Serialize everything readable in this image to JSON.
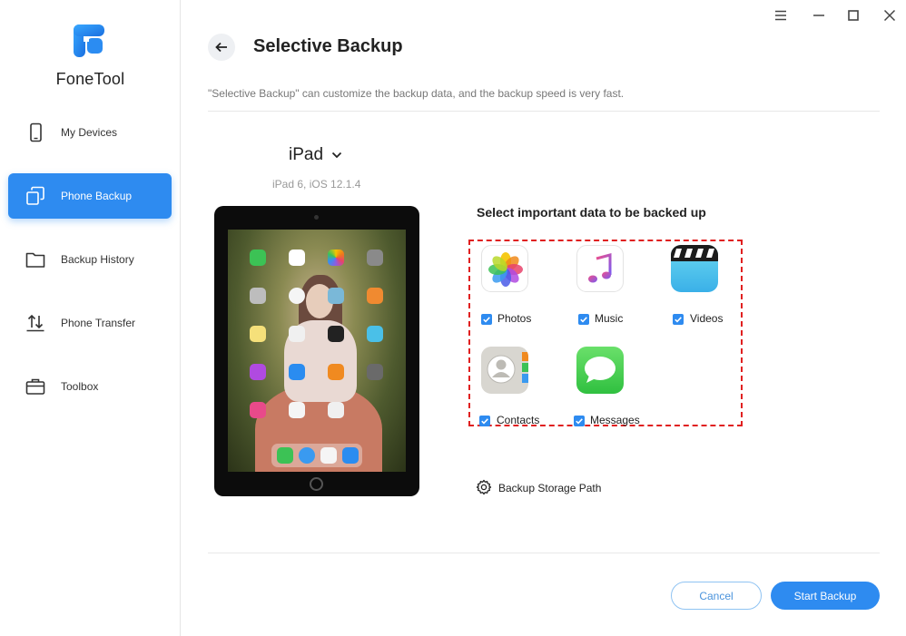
{
  "app": {
    "name": "FoneTool"
  },
  "sidebar": {
    "items": [
      {
        "label": "My Devices",
        "icon": "phone-icon",
        "active": false
      },
      {
        "label": "Phone Backup",
        "icon": "backup-icon",
        "active": true
      },
      {
        "label": "Backup History",
        "icon": "folder-icon",
        "active": false
      },
      {
        "label": "Phone Transfer",
        "icon": "transfer-icon",
        "active": false
      },
      {
        "label": "Toolbox",
        "icon": "toolbox-icon",
        "active": false
      }
    ]
  },
  "header": {
    "title": "Selective Backup",
    "description": "\"Selective Backup\" can customize the backup data, and the backup speed is very fast."
  },
  "device": {
    "name": "iPad",
    "info": "iPad 6, iOS 12.1.4"
  },
  "selection": {
    "title": "Select important data to be backed up",
    "items": [
      {
        "label": "Photos",
        "checked": true,
        "icon": "photos-icon"
      },
      {
        "label": "Music",
        "checked": true,
        "icon": "music-icon"
      },
      {
        "label": "Videos",
        "checked": true,
        "icon": "videos-icon"
      },
      {
        "label": "Contacts",
        "checked": true,
        "icon": "contacts-icon"
      },
      {
        "label": "Messages",
        "checked": true,
        "icon": "messages-icon"
      }
    ]
  },
  "storage": {
    "label": "Backup Storage Path"
  },
  "buttons": {
    "cancel": "Cancel",
    "start": "Start Backup"
  },
  "colors": {
    "accent": "#2e8bf0",
    "highlight": "#e02020"
  }
}
